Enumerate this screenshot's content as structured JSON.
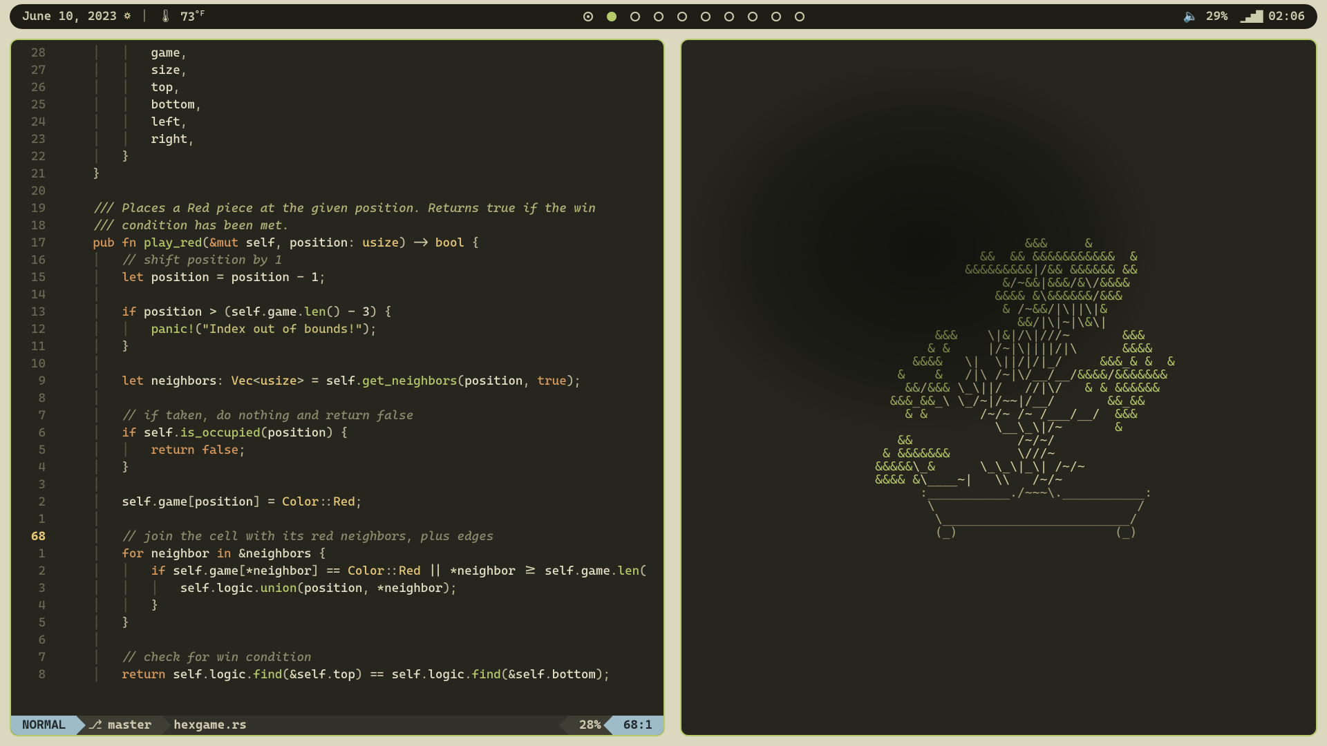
{
  "topbar": {
    "date": "June 10, 2023",
    "weather_icon": "sun-icon",
    "temp_value": "73",
    "temp_unit": "°F",
    "workspace_count": 10,
    "active_workspace_index": 1,
    "special_workspace_index": 0,
    "battery_icon": "speaker-icon",
    "battery_pct": "29%",
    "signal_icon": "signal-icon",
    "clock": "02:06"
  },
  "editor": {
    "mode": "NORMAL",
    "branch": "master",
    "filename": "hexgame.rs",
    "scroll_pct": "28%",
    "cursor_pos": "68:1",
    "relative_numbers_current": "68",
    "gutter": [
      "28",
      "27",
      "26",
      "25",
      "24",
      "23",
      "22",
      "21",
      "20",
      "19",
      "18",
      "17",
      "16",
      "15",
      "14",
      "13",
      "12",
      "11",
      "10",
      "9",
      "8",
      "7",
      "6",
      "5",
      "4",
      "3",
      "2",
      "1",
      "68",
      "1",
      "2",
      "3",
      "4",
      "5",
      "6",
      "7",
      "8"
    ]
  },
  "code": {
    "l0": "game",
    "l1": "size",
    "l2": "top",
    "l3": "bottom",
    "l4": "left",
    "l5": "right",
    "doc1": "/// Places a Red piece at the given position. Returns true if the win",
    "doc2": "/// condition has been met.",
    "c_shift": "// shift position by 1",
    "s_oob": "\"Index out of bounds!\"",
    "c_taken": "// if taken, do nothing and return false",
    "c_join": "// join the cell with its red neighbors, plus edges",
    "c_win": "// check for win condition"
  },
  "bonsai": {
    "lines": [
      "                           &&&     &",
      "                     &&  && &&&&&&&&&&&  &",
      "                   &&&&&&&&&|/&& &&&&&& &&",
      "                        &/~&&|&&&/&\\/&&&&",
      "                       &&&& &\\&&&&&&/&&&",
      "                        & /~&&/|\\||\\|&",
      "                          &&/|\\|~|\\&\\|",
      "               &&&    \\|&|/\\|///~       &&&",
      "              & &     |/~|\\||||/|\\      &&&&",
      "            &&&&   \\|  \\||/|/|_/     &&&_& &  &",
      "          &    &   /|\\ /~|\\/__/__/&&&&/&&&&&&&",
      "           &&/&&& \\_\\||/   //|\\/   & & &&&&&&",
      "         &&&_&&_\\ \\_/~|/~~|/__/       &&_&&",
      "           & &       /~/~ /~ /___/__/  &&&",
      "                       \\__\\_\\|/~       &",
      "          &&              /~/~/",
      "        & &&&&&&&         \\///~",
      "       &&&&&\\_&      \\_\\_\\|_\\| /~/~",
      "       &&&& &\\____~|   \\\\   /~/~",
      "             :___________./~~~\\.___________:",
      "              \\                           /",
      "               \\_________________________/",
      "               (_)                     (_)"
    ],
    "trunk_start_index": 3,
    "pot_start_index": 19
  }
}
